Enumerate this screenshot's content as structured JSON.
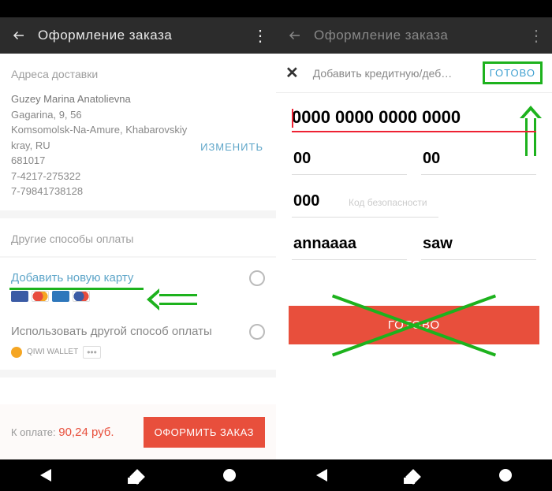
{
  "left": {
    "header_title": "Оформление заказа",
    "section_addr": "Адреса доставки",
    "addr": {
      "name": "Guzey Marina Anatolievna",
      "line1": "Gagarina, 9, 56",
      "line2": "Komsomolsk-Na-Amure, Khabarovskiy",
      "line3": "kray, RU",
      "zip": "681017",
      "phone1": "7-4217-275322",
      "phone2": "7-79841738128",
      "edit": "ИЗМЕНИТЬ"
    },
    "section_pay": "Другие способы оплаты",
    "add_card": "Добавить новую карту",
    "other_pay": "Использовать другой способ оплаты",
    "wallet_label": "QIWI WALLET",
    "total_label": "К оплате: ",
    "total_value": "90,24 руб.",
    "submit": "ОФОРМИТЬ ЗАКАЗ"
  },
  "right": {
    "header_title": "Оформление заказа",
    "modal_title": "Добавить кредитную/деб…",
    "done_small": "ГОТОВО",
    "card_number": "0000 0000 0000 0000",
    "exp_month": "00",
    "exp_year": "00",
    "cvv": "000",
    "cvv_label": "Код безопасности",
    "first_name": "annaaaa",
    "last_name": "saw",
    "done_big": "ГОТОВО"
  }
}
